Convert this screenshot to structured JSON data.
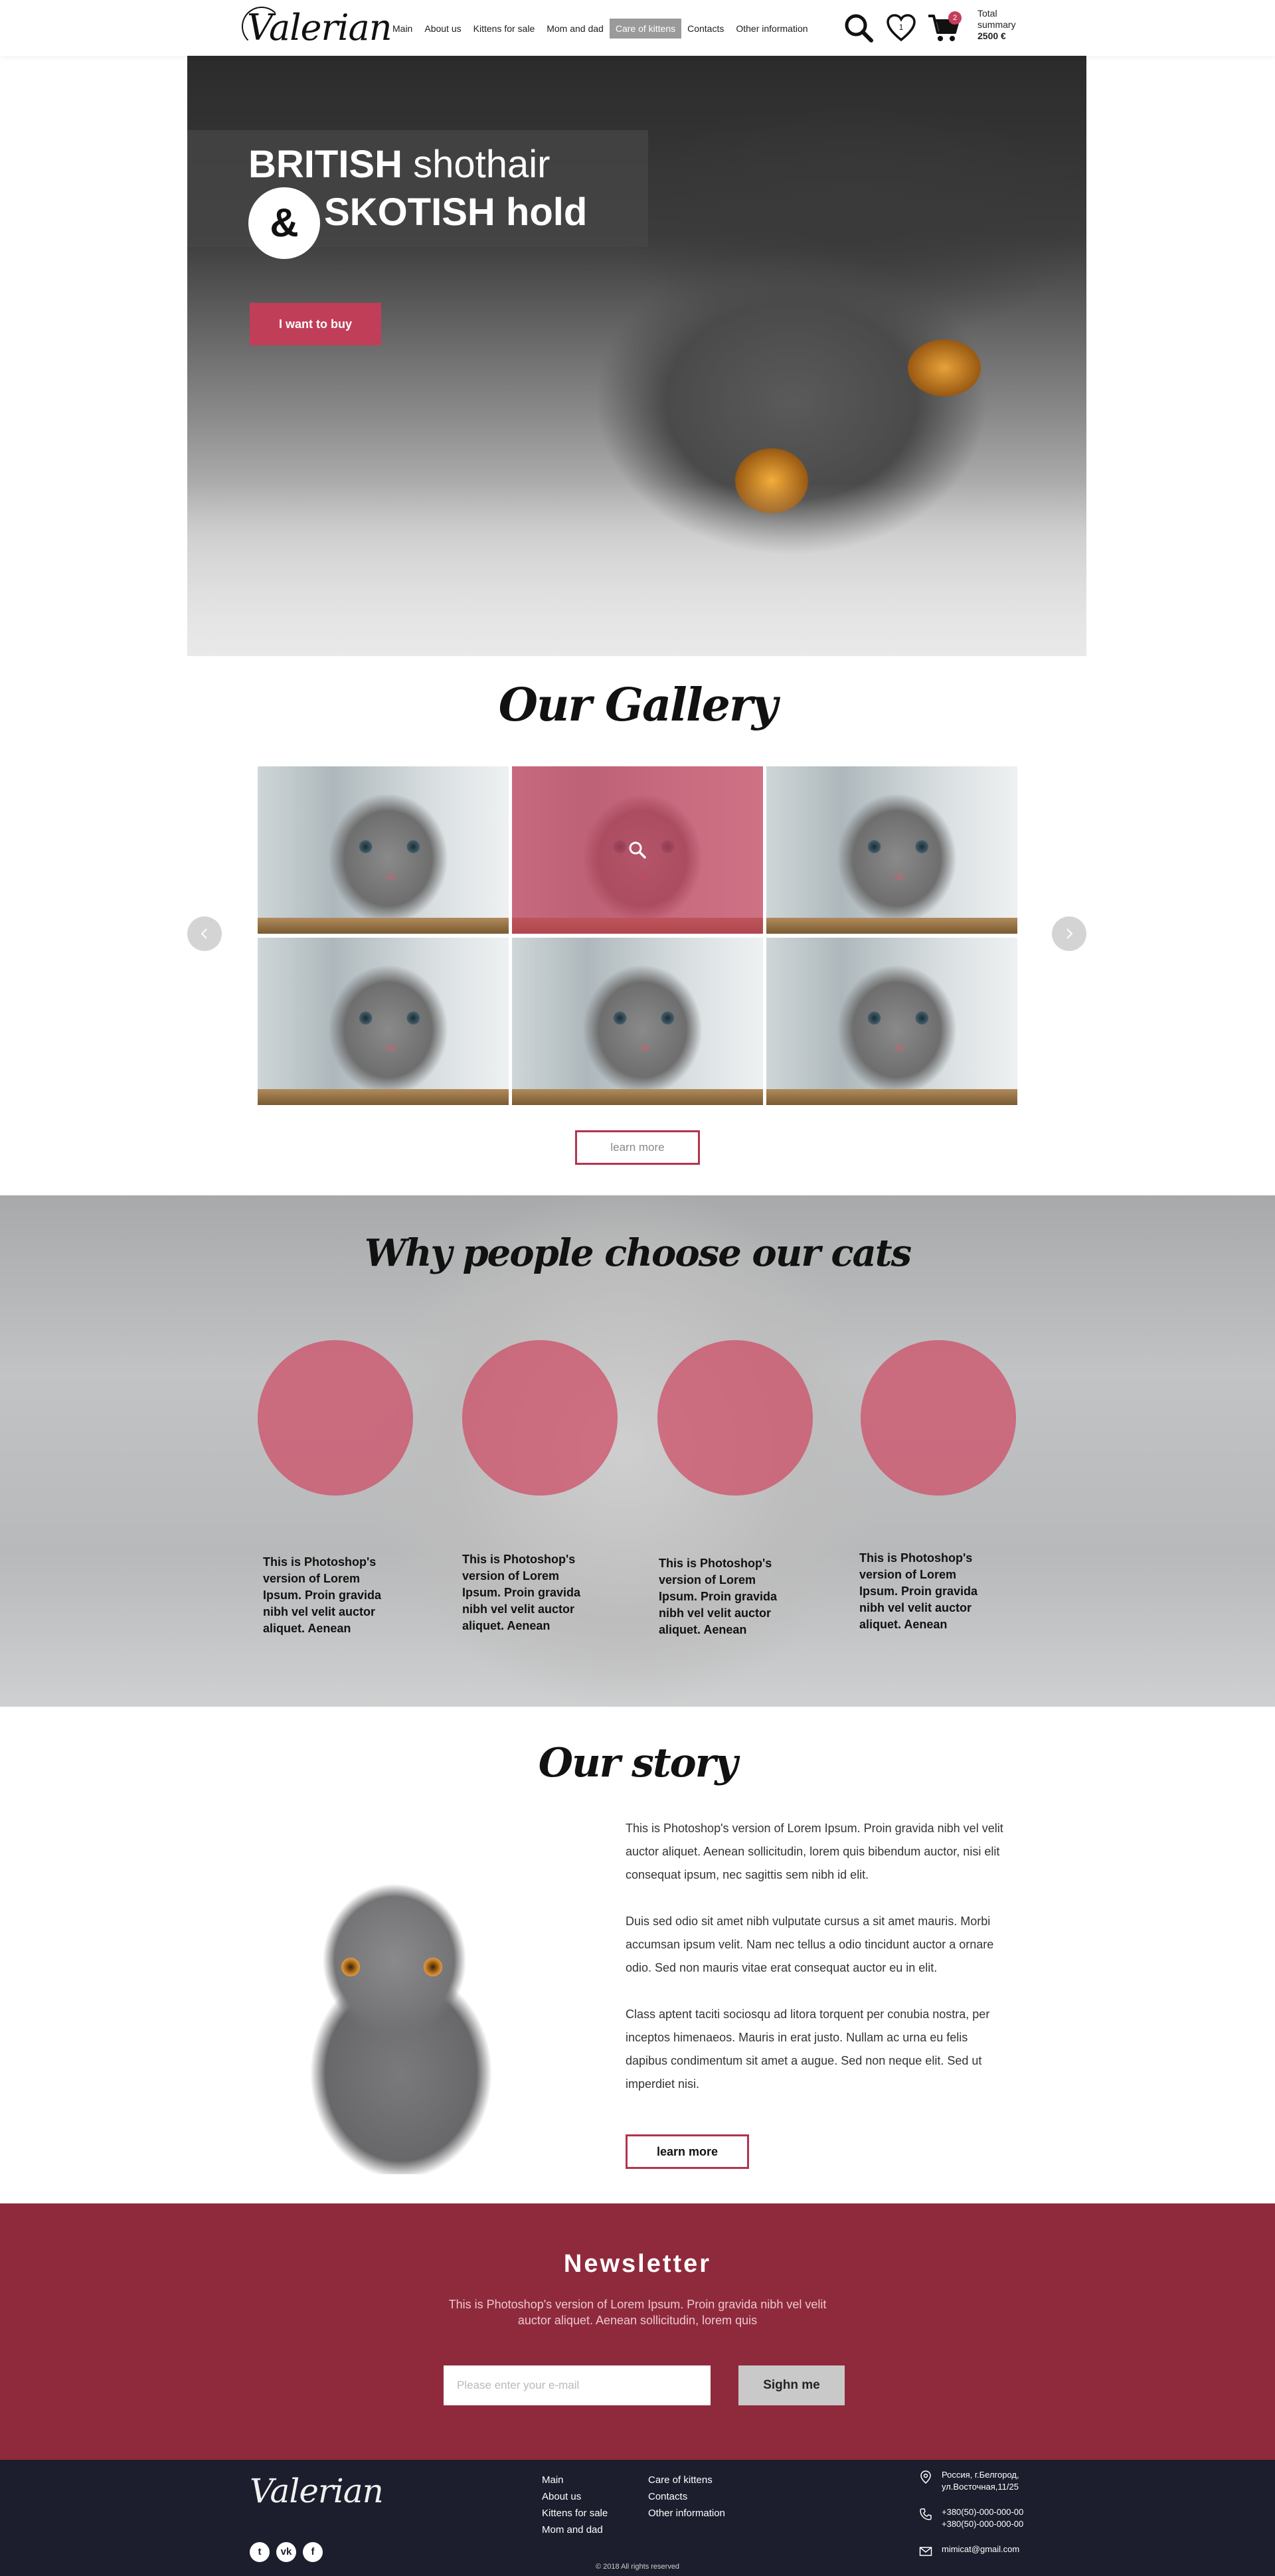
{
  "header": {
    "logo": "Valerian",
    "nav": [
      "Main",
      "About us",
      "Kittens for sale",
      "Mom and dad",
      "Care of kittens",
      "Contacts",
      "Other information"
    ],
    "active_nav": "Care of kittens",
    "wishlist_count": "1",
    "cart_count": "2",
    "total_label": "Total summary",
    "total_value": "2500 €"
  },
  "hero": {
    "title_word1": "BRITISH",
    "title_word2": "shothair",
    "ampersand": "&",
    "title_line2": "SKOTISH hold",
    "cta": "I want to buy"
  },
  "gallery": {
    "title": "Our Gallery",
    "items_count": 6,
    "highlighted_index": 1,
    "learn_more": "learn more"
  },
  "why": {
    "title": "Why people choose our cats",
    "items": [
      {
        "text": "This is Photoshop's version  of Lorem Ipsum. Proin gravida nibh vel velit auctor aliquet. Aenean"
      },
      {
        "text": "This is Photoshop's version  of Lorem Ipsum. Proin gravida nibh vel velit auctor aliquet. Aenean"
      },
      {
        "text": "This is Photoshop's version  of Lorem Ipsum. Proin gravida nibh vel velit auctor aliquet. Aenean"
      },
      {
        "text": "This is Photoshop's version  of Lorem Ipsum. Proin gravida nibh vel velit auctor aliquet. Aenean"
      }
    ]
  },
  "story": {
    "title": "Our story",
    "paragraphs": [
      "This is Photoshop's version  of Lorem Ipsum. Proin gravida nibh vel velit auctor aliquet. Aenean sollicitudin, lorem quis bibendum auctor, nisi elit consequat ipsum, nec sagittis sem nibh id elit.",
      "Duis sed odio sit amet nibh vulputate cursus a sit amet mauris. Morbi accumsan ipsum velit. Nam nec tellus a odio tincidunt auctor a ornare odio. Sed non  mauris vitae erat consequat auctor eu in elit.",
      "Class aptent taciti sociosqu ad litora torquent per conubia nostra, per inceptos himenaeos. Mauris in erat justo. Nullam ac urna eu felis dapibus condimentum sit amet a augue. Sed non neque elit. Sed ut imperdiet nisi."
    ],
    "button": "learn more"
  },
  "newsletter": {
    "title": "Newsletter",
    "subtitle": "This is Photoshop's version  of Lorem Ipsum. Proin gravida nibh vel velit auctor aliquet. Aenean sollicitudin, lorem quis",
    "email_placeholder": "Please enter your e-mail",
    "email_value": "",
    "button": "Sighn me"
  },
  "footer": {
    "logo": "Valerian",
    "col1": [
      "Main",
      "About us",
      "Kittens for sale",
      "Mom and dad"
    ],
    "col2": [
      "Care of kittens",
      "Contacts",
      "Other information"
    ],
    "address": [
      "Россия, г.Белгород,",
      "ул.Восточная,11/25"
    ],
    "phones": [
      "+380(50)-000-000-00",
      "+380(50)-000-000-00"
    ],
    "email": "mimicat@gmail.com",
    "social": [
      "twitter-icon",
      "vk-icon",
      "facebook-icon"
    ],
    "copyright": "© 2018 All rights reserved"
  },
  "colors": {
    "accent": "#c13e58",
    "newsletter_bg": "#8f2a3c",
    "footer_bg": "#1c1e2d",
    "active_nav_bg": "#9a9a9a"
  }
}
